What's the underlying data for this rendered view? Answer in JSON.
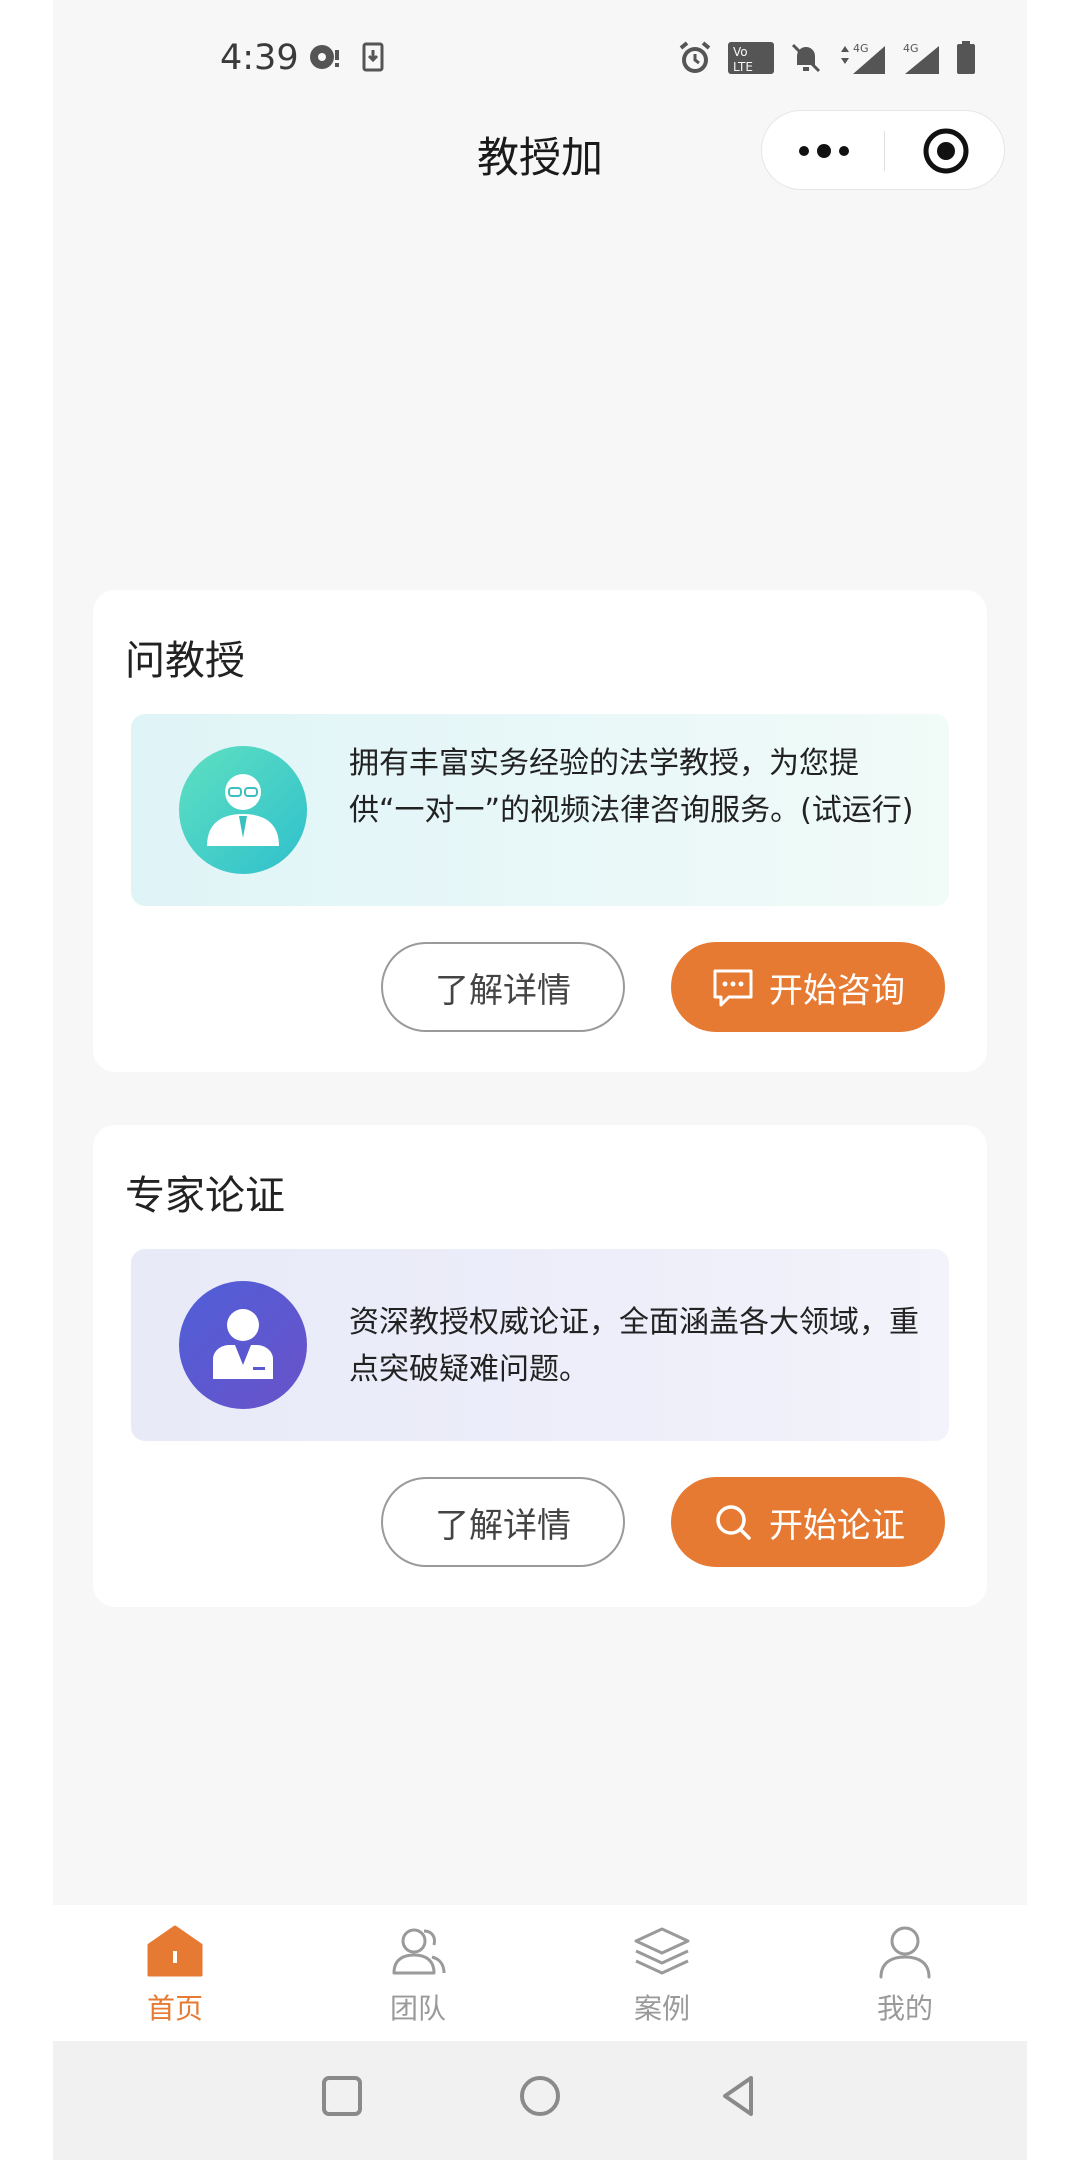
{
  "status_bar": {
    "time": "4:39",
    "network_1": "4G",
    "network_2": "4G"
  },
  "nav": {
    "title": "教授加"
  },
  "cards": [
    {
      "title": "问教授",
      "description": "拥有丰富实务经验的法学教授，为您提供“一对一”的视频法律咨询服务。(试运行)",
      "details_label": "了解详情",
      "action_label": "开始咨询"
    },
    {
      "title": "专家论证",
      "description": "资深教授权威论证，全面涵盖各大领域，重点突破疑难问题。",
      "details_label": "了解详情",
      "action_label": "开始论证"
    }
  ],
  "tabbar": {
    "items": [
      {
        "label": "首页",
        "icon": "home-icon",
        "active": true
      },
      {
        "label": "团队",
        "icon": "team-icon",
        "active": false
      },
      {
        "label": "案例",
        "icon": "layers-icon",
        "active": false
      },
      {
        "label": "我的",
        "icon": "user-icon",
        "active": false
      }
    ]
  },
  "colors": {
    "accent": "#e67a33",
    "background": "#f7f7f7"
  }
}
